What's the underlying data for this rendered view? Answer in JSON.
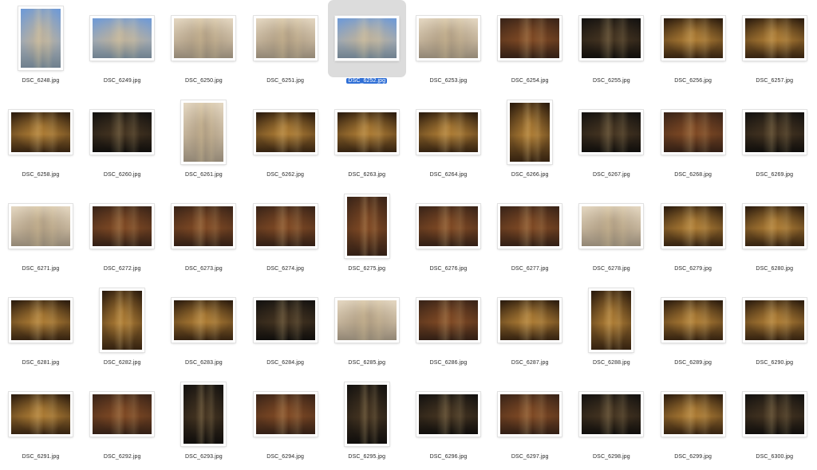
{
  "window": {
    "view": "icon-grid"
  },
  "selected_index": 4,
  "files": [
    {
      "name": "DSC_6248.jpg",
      "orient": "portrait",
      "tone": "sky"
    },
    {
      "name": "DSC_6249.jpg",
      "orient": "landscape",
      "tone": "sky"
    },
    {
      "name": "DSC_6250.jpg",
      "orient": "landscape",
      "tone": "stone"
    },
    {
      "name": "DSC_6251.jpg",
      "orient": "landscape",
      "tone": "stone"
    },
    {
      "name": "DSC_6252.jpg",
      "orient": "landscape",
      "tone": "sky"
    },
    {
      "name": "DSC_6253.jpg",
      "orient": "landscape",
      "tone": "stone"
    },
    {
      "name": "DSC_6254.jpg",
      "orient": "landscape",
      "tone": "warm"
    },
    {
      "name": "DSC_6255.jpg",
      "orient": "landscape",
      "tone": "dark"
    },
    {
      "name": "DSC_6256.jpg",
      "orient": "landscape",
      "tone": "gold"
    },
    {
      "name": "DSC_6257.jpg",
      "orient": "landscape",
      "tone": "gold"
    },
    {
      "name": "DSC_6258.jpg",
      "orient": "landscape",
      "tone": "gold"
    },
    {
      "name": "DSC_6260.jpg",
      "orient": "landscape",
      "tone": "dark"
    },
    {
      "name": "DSC_6261.jpg",
      "orient": "portrait",
      "tone": "stone"
    },
    {
      "name": "DSC_6262.jpg",
      "orient": "landscape",
      "tone": "gold"
    },
    {
      "name": "DSC_6263.jpg",
      "orient": "landscape",
      "tone": "gold"
    },
    {
      "name": "DSC_6264.jpg",
      "orient": "landscape",
      "tone": "gold"
    },
    {
      "name": "DSC_6266.jpg",
      "orient": "portrait",
      "tone": "gold"
    },
    {
      "name": "DSC_6267.jpg",
      "orient": "landscape",
      "tone": "dark"
    },
    {
      "name": "DSC_6268.jpg",
      "orient": "landscape",
      "tone": "warm"
    },
    {
      "name": "DSC_6269.jpg",
      "orient": "landscape",
      "tone": "dark"
    },
    {
      "name": "DSC_6271.jpg",
      "orient": "landscape",
      "tone": "stone"
    },
    {
      "name": "DSC_6272.jpg",
      "orient": "landscape",
      "tone": "warm"
    },
    {
      "name": "DSC_6273.jpg",
      "orient": "landscape",
      "tone": "warm"
    },
    {
      "name": "DSC_6274.jpg",
      "orient": "landscape",
      "tone": "warm"
    },
    {
      "name": "DSC_6275.jpg",
      "orient": "portrait",
      "tone": "warm"
    },
    {
      "name": "DSC_6276.jpg",
      "orient": "landscape",
      "tone": "warm"
    },
    {
      "name": "DSC_6277.jpg",
      "orient": "landscape",
      "tone": "warm"
    },
    {
      "name": "DSC_6278.jpg",
      "orient": "landscape",
      "tone": "stone"
    },
    {
      "name": "DSC_6279.jpg",
      "orient": "landscape",
      "tone": "gold"
    },
    {
      "name": "DSC_6280.jpg",
      "orient": "landscape",
      "tone": "gold"
    },
    {
      "name": "DSC_6281.jpg",
      "orient": "landscape",
      "tone": "gold"
    },
    {
      "name": "DSC_6282.jpg",
      "orient": "portrait",
      "tone": "gold"
    },
    {
      "name": "DSC_6283.jpg",
      "orient": "landscape",
      "tone": "gold"
    },
    {
      "name": "DSC_6284.jpg",
      "orient": "landscape",
      "tone": "dark"
    },
    {
      "name": "DSC_6285.jpg",
      "orient": "landscape",
      "tone": "stone"
    },
    {
      "name": "DSC_6286.jpg",
      "orient": "landscape",
      "tone": "warm"
    },
    {
      "name": "DSC_6287.jpg",
      "orient": "landscape",
      "tone": "gold"
    },
    {
      "name": "DSC_6288.jpg",
      "orient": "portrait",
      "tone": "gold"
    },
    {
      "name": "DSC_6289.jpg",
      "orient": "landscape",
      "tone": "gold"
    },
    {
      "name": "DSC_6290.jpg",
      "orient": "landscape",
      "tone": "gold"
    },
    {
      "name": "DSC_6291.jpg",
      "orient": "landscape",
      "tone": "gold"
    },
    {
      "name": "DSC_6292.jpg",
      "orient": "landscape",
      "tone": "warm"
    },
    {
      "name": "DSC_6293.jpg",
      "orient": "portrait",
      "tone": "dark"
    },
    {
      "name": "DSC_6294.jpg",
      "orient": "landscape",
      "tone": "warm"
    },
    {
      "name": "DSC_6295.jpg",
      "orient": "portrait",
      "tone": "dark"
    },
    {
      "name": "DSC_6296.jpg",
      "orient": "landscape",
      "tone": "dark"
    },
    {
      "name": "DSC_6297.jpg",
      "orient": "landscape",
      "tone": "warm"
    },
    {
      "name": "DSC_6298.jpg",
      "orient": "landscape",
      "tone": "dark"
    },
    {
      "name": "DSC_6299.jpg",
      "orient": "landscape",
      "tone": "gold"
    },
    {
      "name": "DSC_6300.jpg",
      "orient": "landscape",
      "tone": "dark"
    }
  ],
  "tones": {
    "sky": [
      "#6f9ad6",
      "#c9b593",
      "#6e6a52"
    ],
    "stone": [
      "#e3d6c0",
      "#a8957a",
      "#4e4436"
    ],
    "warm": [
      "#3a2418",
      "#8a4f26",
      "#2a1a12"
    ],
    "gold": [
      "#2c1c0e",
      "#c08a3a",
      "#3a2612"
    ],
    "dark": [
      "#141210",
      "#4d3a24",
      "#0c0a08"
    ]
  },
  "colors": {
    "selection_bg": "#dcdcdc",
    "label_highlight": "#2f6fd6"
  }
}
